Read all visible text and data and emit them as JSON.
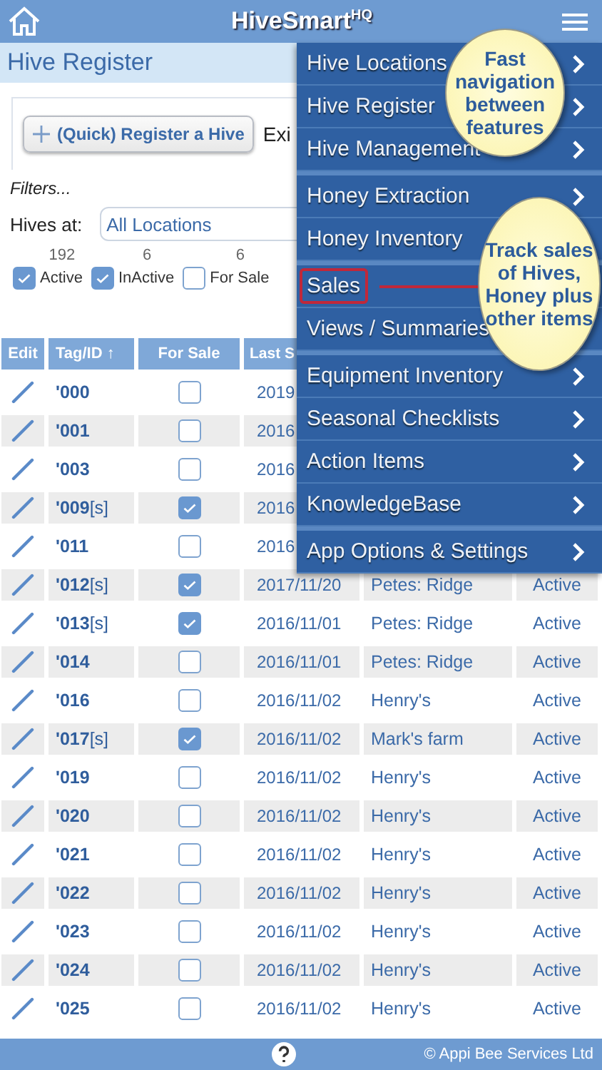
{
  "header": {
    "title": "HiveSmart$^{HQ}$"
  },
  "page_title": "Hive Register",
  "register_button": "(Quick) Register a Hive",
  "card_text": "Exi",
  "filters_label": "Filters...",
  "location_filter": {
    "label": "Hives at:",
    "value": "All Locations"
  },
  "status_filters": [
    {
      "count": "192",
      "label": "Active",
      "checked": true
    },
    {
      "count": "6",
      "label": "InActive",
      "checked": true
    },
    {
      "count": "6",
      "label": "For Sale",
      "checked": false
    }
  ],
  "table": {
    "columns": [
      "Edit",
      "Tag/ID ↑",
      "For Sale",
      "Last S"
    ],
    "rows": [
      {
        "tag": "**'000**",
        "for_sale": false,
        "date": "2019"
      },
      {
        "tag": "**'001**",
        "for_sale": false,
        "date": "2016"
      },
      {
        "tag": "**'003**",
        "for_sale": false,
        "date": "2016"
      },
      {
        "tag": "**'009**[s]",
        "for_sale": true,
        "date": "2016"
      },
      {
        "tag": "**'011**",
        "for_sale": false,
        "date": "2016"
      },
      {
        "tag": "**'012**[s]",
        "for_sale": true,
        "date": "2017/11/20",
        "location": "Petes: Ridge",
        "status": "Active"
      },
      {
        "tag": "**'013**[s]",
        "for_sale": true,
        "date": "2016/11/01",
        "location": "Petes: Ridge",
        "status": "Active"
      },
      {
        "tag": "**'014**",
        "for_sale": false,
        "date": "2016/11/01",
        "location": "Petes: Ridge",
        "status": "Active"
      },
      {
        "tag": "**'016**",
        "for_sale": false,
        "date": "2016/11/02",
        "location": "Henry's",
        "status": "Active"
      },
      {
        "tag": "**'017**[s]",
        "for_sale": true,
        "date": "2016/11/02",
        "location": "Mark's farm",
        "status": "Active"
      },
      {
        "tag": "**'019**",
        "for_sale": false,
        "date": "2016/11/02",
        "location": "Henry's",
        "status": "Active"
      },
      {
        "tag": "**'020**",
        "for_sale": false,
        "date": "2016/11/02",
        "location": "Henry's",
        "status": "Active"
      },
      {
        "tag": "**'021**",
        "for_sale": false,
        "date": "2016/11/02",
        "location": "Henry's",
        "status": "Active"
      },
      {
        "tag": "**'022**",
        "for_sale": false,
        "date": "2016/11/02",
        "location": "Henry's",
        "status": "Active"
      },
      {
        "tag": "**'023**",
        "for_sale": false,
        "date": "2016/11/02",
        "location": "Henry's",
        "status": "Active"
      },
      {
        "tag": "**'024**",
        "for_sale": false,
        "date": "2016/11/02",
        "location": "Henry's",
        "status": "Active"
      },
      {
        "tag": "**'025**",
        "for_sale": false,
        "date": "2016/11/02",
        "location": "Henry's",
        "status": "Active"
      }
    ]
  },
  "menu": {
    "groups": [
      {
        "items": [
          {
            "label": "Hive Locations",
            "chevron": true,
            "highlighted": false
          },
          {
            "label": "Hive Register",
            "chevron": true,
            "highlighted": false
          },
          {
            "label": "Hive Management",
            "chevron": true,
            "highlighted": false
          }
        ]
      },
      {
        "items": [
          {
            "label": "Honey Extraction",
            "chevron": true,
            "highlighted": false
          },
          {
            "label": "Honey Inventory",
            "chevron": false,
            "highlighted": false
          }
        ]
      },
      {
        "items": [
          {
            "label": "Sales",
            "chevron": false,
            "highlighted": true
          },
          {
            "label": "Views / Summaries",
            "chevron": false,
            "highlighted": false
          }
        ]
      },
      {
        "items": [
          {
            "label": "Equipment Inventory",
            "chevron": true,
            "highlighted": false
          },
          {
            "label": "Seasonal Checklists",
            "chevron": true,
            "highlighted": false
          },
          {
            "label": "Action Items",
            "chevron": true,
            "highlighted": false
          },
          {
            "label": "KnowledgeBase",
            "chevron": true,
            "highlighted": false
          }
        ]
      },
      {
        "items": [
          {
            "label": "App Options & Settings",
            "chevron": true,
            "highlighted": false
          }
        ]
      }
    ]
  },
  "callouts": [
    {
      "text": "Fast navigation between features"
    },
    {
      "text": "Track sales of Hives, Honey plus other items"
    }
  ],
  "footer": {
    "copyright": "© Appi Bee Services Ltd"
  }
}
